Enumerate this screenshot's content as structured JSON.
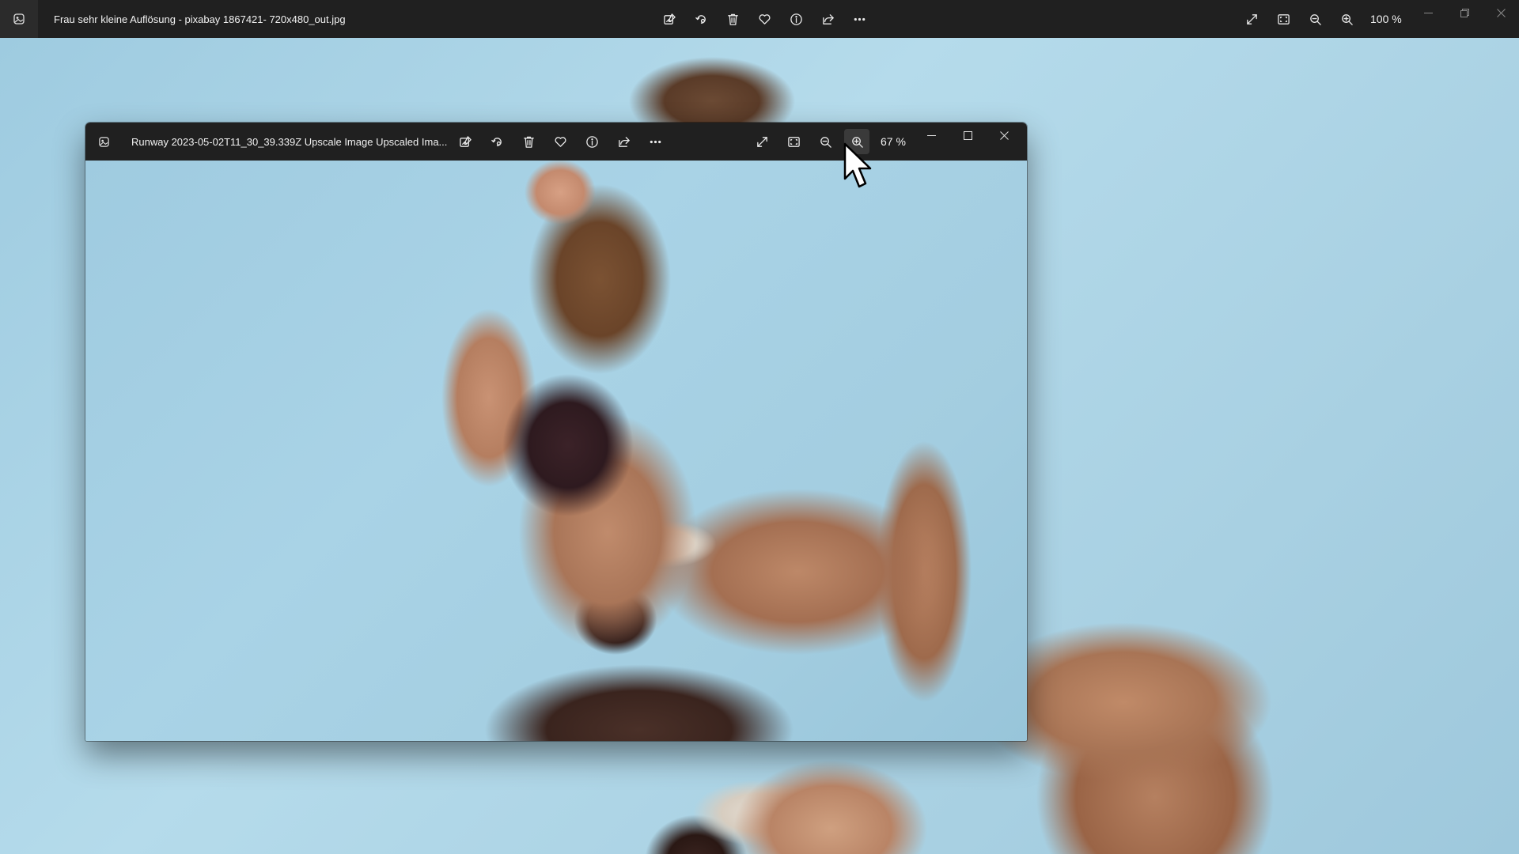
{
  "main_window": {
    "title": "Frau sehr kleine Auflösung - pixabay 1867421- 720x480_out.jpg",
    "zoom_label": "100 %",
    "toolbar_icons": [
      "edit-image-icon",
      "rotate-icon",
      "delete-icon",
      "favorite-icon",
      "info-icon",
      "share-icon",
      "more-icon"
    ],
    "view_icons": [
      "fullscreen-icon",
      "fit-to-window-icon",
      "zoom-out-icon",
      "zoom-in-icon"
    ]
  },
  "float_window": {
    "title": "Runway 2023-05-02T11_30_39.339Z Upscale Image Upscaled Ima...",
    "zoom_label": "67 %",
    "toolbar_icons": [
      "edit-image-icon",
      "rotate-icon",
      "delete-icon",
      "favorite-icon",
      "info-icon",
      "share-icon",
      "more-icon"
    ],
    "view_icons": [
      "fullscreen-icon",
      "fit-to-window-icon",
      "zoom-out-icon",
      "zoom-in-icon"
    ],
    "active_button": "zoom-in-icon"
  }
}
